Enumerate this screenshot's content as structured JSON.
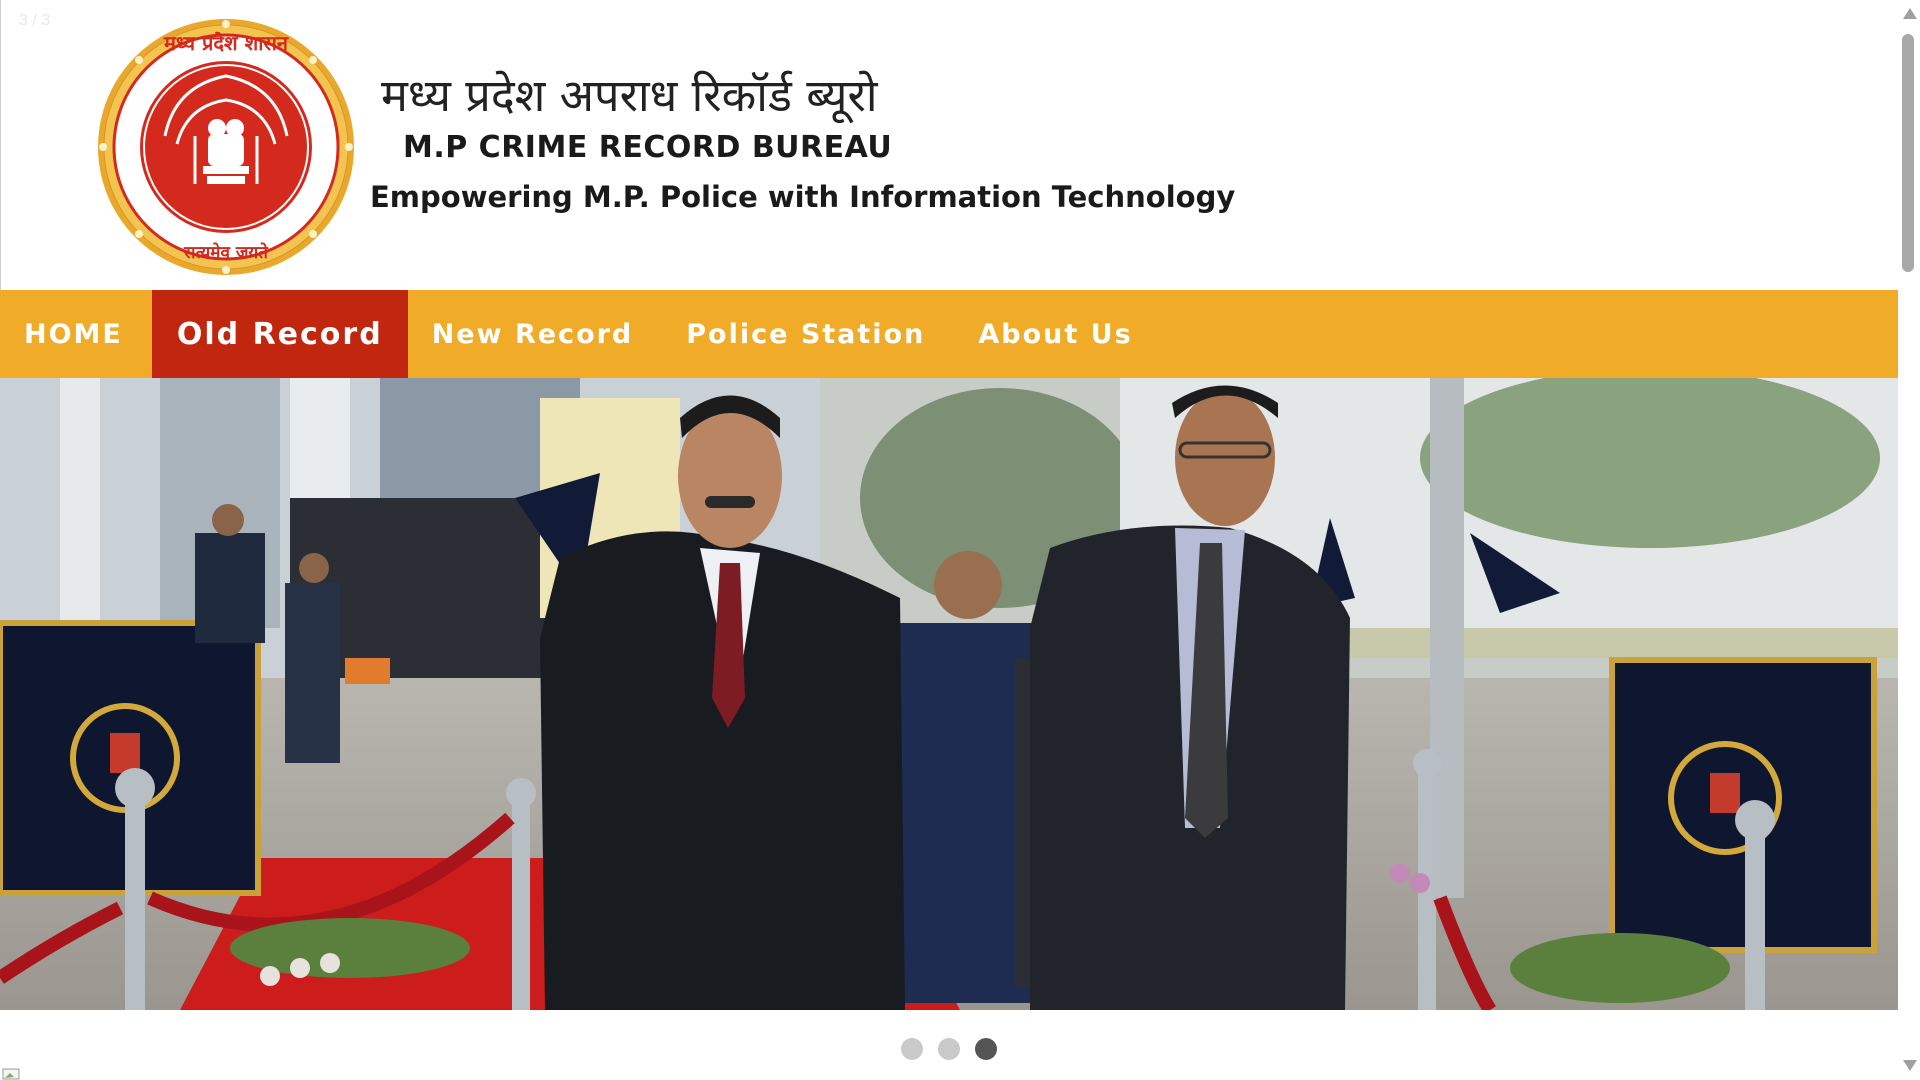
{
  "slider": {
    "counter": "3 / 3",
    "slide_count": 3,
    "active_index": 2
  },
  "header": {
    "logo_name": "mp-police-emblem",
    "title_hindi": "मध्य प्रदेश अपराध रिकॉर्ड ब्यूरो",
    "title_english": "M.P CRIME RECORD BUREAU",
    "tagline": "Empowering M.P. Police with Information Technology"
  },
  "nav": {
    "items": [
      {
        "label": "HOME"
      },
      {
        "label": "Old Record"
      },
      {
        "label": "New Record"
      },
      {
        "label": "Police Station"
      },
      {
        "label": "About Us"
      }
    ],
    "active": "Old Record"
  },
  "colors": {
    "nav_bg": "#f0ac28",
    "nav_active": "#c0270e",
    "logo_red": "#d42a1e",
    "logo_gold": "#e9a82c"
  },
  "icons": {
    "scroll_up": "triangle-up-icon",
    "scroll_down": "triangle-down-icon"
  }
}
